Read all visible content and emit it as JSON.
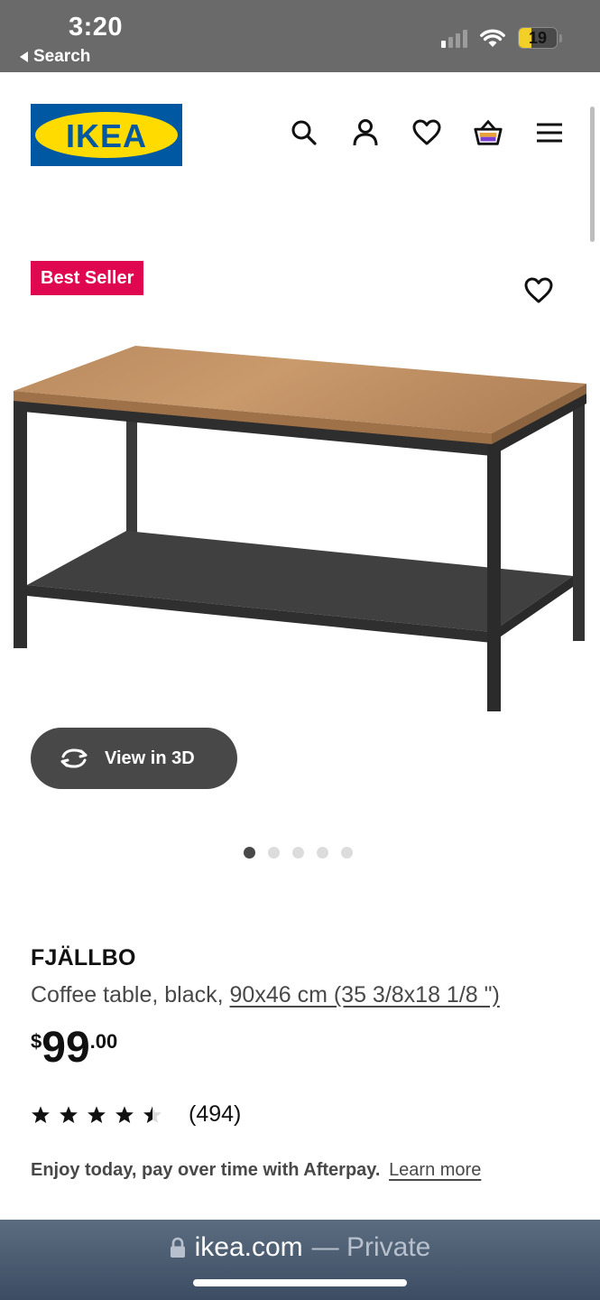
{
  "status_bar": {
    "time": "3:20",
    "back_label": "Search",
    "battery": "19"
  },
  "header": {
    "logo_text": "IKEA",
    "icons": [
      "search-icon",
      "account-icon",
      "favorites-icon",
      "cart-icon",
      "menu-icon"
    ]
  },
  "product": {
    "badge": "Best Seller",
    "view_3d_label": "View in 3D",
    "image_count": 5,
    "active_image": 1,
    "name": "FJÄLLBO",
    "description": "Coffee table, black,",
    "dimensions": "90x46 cm (35 3/8x18 1/8 \")",
    "price": {
      "currency": "$",
      "integer": "99",
      "decimal": ".00"
    },
    "rating": {
      "value": 4.5,
      "max": 5,
      "count": "(494)"
    },
    "afterpay_text": "Enjoy today, pay over time with Afterpay.",
    "afterpay_link": "Learn more"
  },
  "browser": {
    "domain": "ikea.com",
    "mode": "— Private"
  },
  "colors": {
    "status_bg": "#6a6a6a",
    "ikea_blue": "#0058a3",
    "ikea_yellow": "#ffdb00",
    "badge_red": "#e00751",
    "dark_btn": "#484848"
  }
}
